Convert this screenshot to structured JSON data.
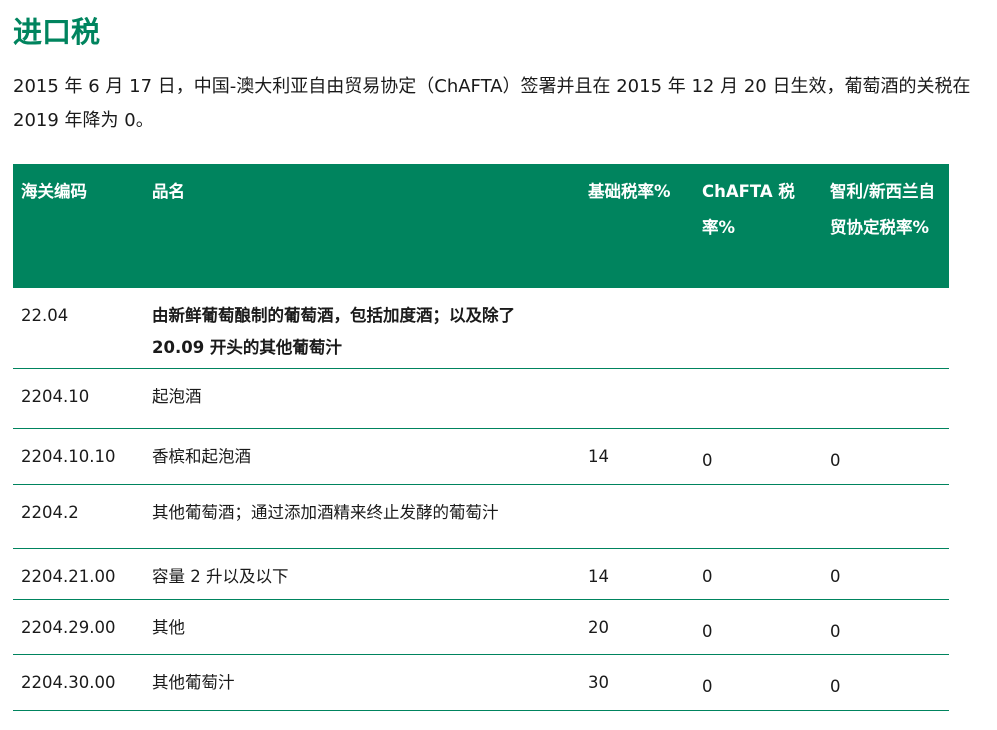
{
  "title": "进口税",
  "intro": "2015 年 6 月 17 日，中国-澳大利亚自由贸易协定（ChAFTA）签署并且在 2015 年 12 月 20 日生效，葡萄酒的关税在 2019 年降为 0。",
  "table": {
    "headers": [
      "海关编码",
      "品名",
      "基础税率%",
      "ChAFTA 税率%",
      "智利/新西兰自贸协定税率%"
    ],
    "rows": [
      {
        "code": "22.04",
        "name": "由新鲜葡萄酿制的葡萄酒，包括加度酒；以及除了 20.09 开头的其他葡萄汁",
        "base": "",
        "chafta": "",
        "fta": "",
        "bold": true
      },
      {
        "code": "2204.10",
        "name": "起泡酒",
        "base": "",
        "chafta": "",
        "fta": ""
      },
      {
        "code": "2204.10.10",
        "name": "香槟和起泡酒",
        "base": "14",
        "chafta": "0",
        "fta": "0"
      },
      {
        "code": "2204.2",
        "name": "其他葡萄酒；通过添加酒精来终止发酵的葡萄汁",
        "base": "",
        "chafta": "",
        "fta": ""
      },
      {
        "code": "2204.21.00",
        "name": "容量 2 升以及以下",
        "base": "14",
        "chafta": "0",
        "fta": "0"
      },
      {
        "code": "2204.29.00",
        "name": "其他",
        "base": "20",
        "chafta": "0",
        "fta": "0"
      },
      {
        "code": "2204.30.00",
        "name": "其他葡萄汁",
        "base": "30",
        "chafta": "0",
        "fta": "0"
      }
    ]
  },
  "colors": {
    "accent": "#00845e",
    "header_text": "#ffffff"
  }
}
